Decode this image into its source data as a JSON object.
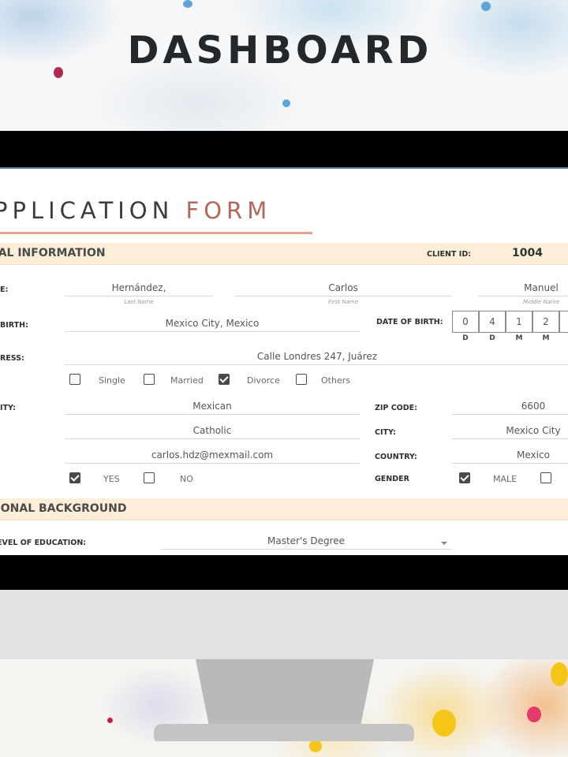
{
  "page": {
    "title": "DASHBOARD"
  },
  "form": {
    "title_main": "PPLICATION",
    "title_accent": "FORM",
    "sections": {
      "personal": "NAL INFORMATION",
      "education": "TIONAL BACKGROUND"
    },
    "client_id_label": "CLIENT ID:",
    "client_id": "1004",
    "name_label": "E:",
    "last_name": "Hernández,",
    "last_name_caption": "Last Name",
    "first_name": "Carlos",
    "first_name_caption": "First Name",
    "middle_name": "Manuel",
    "middle_name_caption": "Middle Name",
    "place_of_birth_label": "BIRTH:",
    "place_of_birth": "Mexico City, Mexico",
    "date_of_birth_label": "DATE OF BIRTH:",
    "date_of_birth_digits": [
      "0",
      "4",
      "1",
      "2",
      ""
    ],
    "date_of_birth_marks": [
      "D",
      "D",
      "M",
      "M"
    ],
    "address_label": "RESS:",
    "address": "Calle Londres 247, Juárez",
    "civil_status": [
      {
        "label": "Single",
        "checked": false
      },
      {
        "label": "Married",
        "checked": false
      },
      {
        "label": "Divorce",
        "checked": true
      },
      {
        "label": "Others",
        "checked": false
      }
    ],
    "nationality_label": "ITY:",
    "nationality": "Mexican",
    "religion": "Catholic",
    "email": "carlos.hdz@mexmail.com",
    "zip_label": "ZIP CODE:",
    "zip": "6600",
    "city_label": "CITY:",
    "city": "Mexico City",
    "country_label": "COUNTRY:",
    "country": "Mexico",
    "yes_no": [
      {
        "label": "YES",
        "checked": true
      },
      {
        "label": "NO",
        "checked": false
      }
    ],
    "gender_label": "GENDER",
    "gender_options": [
      {
        "label": "MALE",
        "checked": true
      },
      {
        "label": "",
        "checked": false
      }
    ],
    "education_label": "EVEL OF EDUCATION:",
    "education_value": "Master's Degree"
  }
}
